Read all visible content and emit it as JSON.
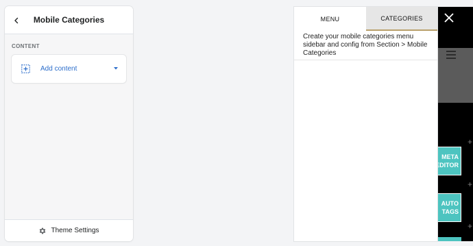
{
  "editor": {
    "title": "Mobile Categories",
    "section_label": "CONTENT",
    "add_content_label": "Add content",
    "footer_label": "Theme Settings",
    "icons": {
      "back": "chevron-left-icon",
      "add": "add-section-icon",
      "caret": "caret-down-icon",
      "settings": "gear-icon"
    },
    "colors": {
      "accent": "#2c6ecb"
    }
  },
  "preview": {
    "tabs": [
      {
        "label": "MENU",
        "active": false
      },
      {
        "label": "CATEGORIES",
        "active": true
      }
    ],
    "message": "Create your mobile categories menu sidebar and config from Section > Mobile Categories",
    "buttons": [
      {
        "line1": "META",
        "line2": "EDITOR"
      },
      {
        "line1": "AUTO",
        "line2": "TAGS"
      }
    ],
    "icons": {
      "close": "close-icon",
      "hamburger": "hamburger-menu-icon",
      "plus": "plus-icon"
    },
    "colors": {
      "teal": "#4dc4c0",
      "active_tab_border": "#b9a06a"
    }
  }
}
